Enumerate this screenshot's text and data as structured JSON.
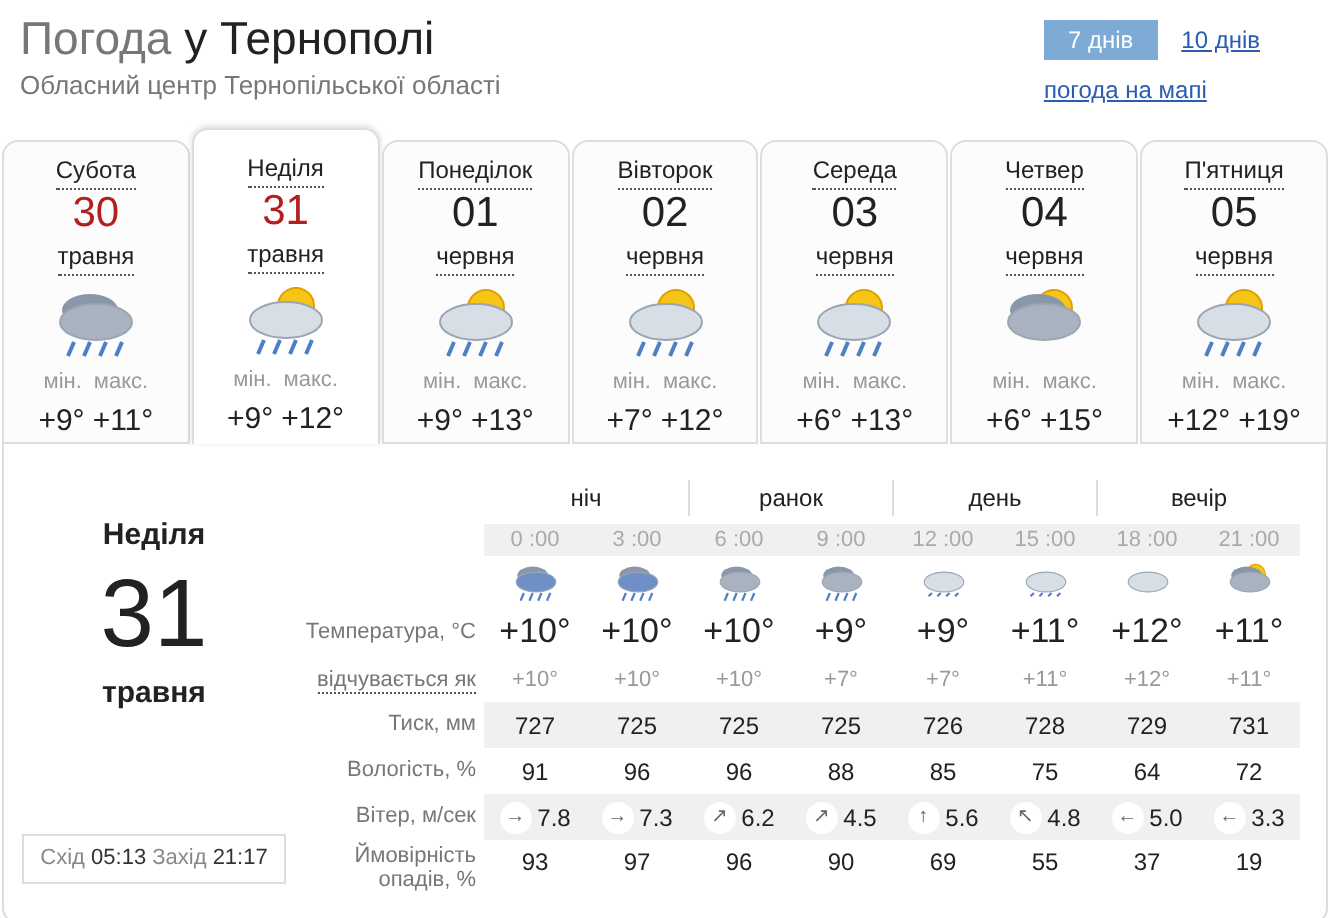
{
  "header": {
    "title_prefix": "Погода",
    "title_city": "у Тернополі",
    "subtitle": "Обласний центр Тернопільської області",
    "periods": [
      {
        "label": "7 днів",
        "selected": true
      },
      {
        "label": "10 днів",
        "selected": false
      }
    ],
    "map_link": "погода на мапі"
  },
  "days": [
    {
      "weekday": "Субота",
      "date": "30",
      "month": "травня",
      "weekend": true,
      "selected": false,
      "kind": "rain",
      "min_label": "мін.",
      "min": "+9°",
      "max_label": "макс.",
      "max": "+11°"
    },
    {
      "weekday": "Неділя",
      "date": "31",
      "month": "травня",
      "weekend": true,
      "selected": true,
      "kind": "sun_rain",
      "min_label": "мін.",
      "min": "+9°",
      "max_label": "макс.",
      "max": "+12°"
    },
    {
      "weekday": "Понеділок",
      "date": "01",
      "month": "червня",
      "weekend": false,
      "selected": false,
      "kind": "sun_rain",
      "min_label": "мін.",
      "min": "+9°",
      "max_label": "макс.",
      "max": "+13°"
    },
    {
      "weekday": "Вівторок",
      "date": "02",
      "month": "червня",
      "weekend": false,
      "selected": false,
      "kind": "sun_rain",
      "min_label": "мін.",
      "min": "+7°",
      "max_label": "макс.",
      "max": "+12°"
    },
    {
      "weekday": "Середа",
      "date": "03",
      "month": "червня",
      "weekend": false,
      "selected": false,
      "kind": "sun_rain",
      "min_label": "мін.",
      "min": "+6°",
      "max_label": "макс.",
      "max": "+13°"
    },
    {
      "weekday": "Четвер",
      "date": "04",
      "month": "червня",
      "weekend": false,
      "selected": false,
      "kind": "sun_cloud",
      "min_label": "мін.",
      "min": "+6°",
      "max_label": "макс.",
      "max": "+15°"
    },
    {
      "weekday": "П'ятниця",
      "date": "05",
      "month": "червня",
      "weekend": false,
      "selected": false,
      "kind": "sun_rain",
      "min_label": "мін.",
      "min": "+12°",
      "max_label": "макс.",
      "max": "+19°"
    }
  ],
  "detail": {
    "weekday": "Неділя",
    "date": "31",
    "month": "травня",
    "sunrise_label": "Схід",
    "sunrise": "05:13",
    "sunset_label": "Захід",
    "sunset": "21:17",
    "periods": [
      "ніч",
      "ранок",
      "день",
      "вечір"
    ],
    "row_labels": {
      "temperature": "Температура, °C",
      "feels_like": "відчувається як",
      "pressure": "Тиск, мм",
      "humidity": "Вологість, %",
      "wind": "Вітер, м/сек",
      "precipitation": "Ймовірність опадів, %"
    },
    "hours": [
      {
        "time": "0 :00",
        "kind": "rain_heavy",
        "temperature": "+10°",
        "feels_like": "+10°",
        "pressure": "727",
        "humidity": "91",
        "wind_dir": "→",
        "wind": "7.8",
        "precipitation": "93"
      },
      {
        "time": "3 :00",
        "kind": "rain_heavy",
        "temperature": "+10°",
        "feels_like": "+10°",
        "pressure": "725",
        "humidity": "96",
        "wind_dir": "→",
        "wind": "7.3",
        "precipitation": "97"
      },
      {
        "time": "6 :00",
        "kind": "rain",
        "temperature": "+10°",
        "feels_like": "+10°",
        "pressure": "725",
        "humidity": "96",
        "wind_dir": "↗",
        "wind": "6.2",
        "precipitation": "96"
      },
      {
        "time": "9 :00",
        "kind": "rain",
        "temperature": "+9°",
        "feels_like": "+7°",
        "pressure": "725",
        "humidity": "88",
        "wind_dir": "↗",
        "wind": "4.5",
        "precipitation": "90"
      },
      {
        "time": "12 :00",
        "kind": "light_rain",
        "temperature": "+9°",
        "feels_like": "+7°",
        "pressure": "726",
        "humidity": "85",
        "wind_dir": "↑",
        "wind": "5.6",
        "precipitation": "69"
      },
      {
        "time": "15 :00",
        "kind": "light_rain",
        "temperature": "+11°",
        "feels_like": "+11°",
        "pressure": "728",
        "humidity": "75",
        "wind_dir": "↖",
        "wind": "4.8",
        "precipitation": "55"
      },
      {
        "time": "18 :00",
        "kind": "cloud",
        "temperature": "+12°",
        "feels_like": "+12°",
        "pressure": "729",
        "humidity": "64",
        "wind_dir": "←",
        "wind": "5.0",
        "precipitation": "37"
      },
      {
        "time": "21 :00",
        "kind": "sun_cloud",
        "temperature": "+11°",
        "feels_like": "+11°",
        "pressure": "731",
        "humidity": "72",
        "wind_dir": "←",
        "wind": "3.3",
        "precipitation": "19"
      }
    ]
  }
}
